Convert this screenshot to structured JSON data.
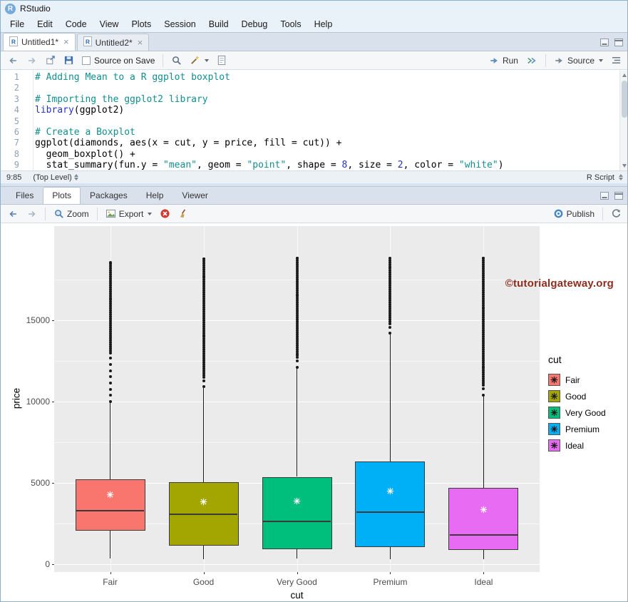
{
  "window": {
    "title": "RStudio"
  },
  "menu": {
    "items": [
      "File",
      "Edit",
      "Code",
      "View",
      "Plots",
      "Session",
      "Build",
      "Debug",
      "Tools",
      "Help"
    ]
  },
  "source_pane": {
    "tabs": [
      {
        "label": "Untitled1*",
        "active": true
      },
      {
        "label": "Untitled2*",
        "active": false
      }
    ],
    "toolbar": {
      "source_on_save": "Source on Save",
      "run": "Run",
      "source": "Source"
    },
    "status": {
      "cursor": "9:85",
      "scope": "(Top Level)",
      "file_type": "R Script"
    },
    "code_lines": [
      [
        [
          "# Adding Mean to a R ggplot boxplot",
          "c"
        ]
      ],
      [],
      [
        [
          "# Importing the ggplot2 library",
          "c"
        ]
      ],
      [
        [
          "library",
          "k"
        ],
        [
          "(ggplot2)",
          "d"
        ]
      ],
      [],
      [
        [
          "# Create a Boxplot",
          "c"
        ]
      ],
      [
        [
          "ggplot(diamonds, aes(x = cut, y = price, fill = cut)) +",
          "d"
        ]
      ],
      [
        [
          "  geom_boxplot() +",
          "d"
        ]
      ],
      [
        [
          "  stat_summary(fun.y = ",
          "d"
        ],
        [
          "\"mean\"",
          "s"
        ],
        [
          ", geom = ",
          "d"
        ],
        [
          "\"point\"",
          "s"
        ],
        [
          ", shape = ",
          "d"
        ],
        [
          "8",
          "n"
        ],
        [
          ", size = ",
          "d"
        ],
        [
          "2",
          "n"
        ],
        [
          ", color = ",
          "d"
        ],
        [
          "\"white\"",
          "s"
        ],
        [
          ")",
          "d"
        ]
      ]
    ]
  },
  "plots_pane": {
    "tabs": [
      "Files",
      "Plots",
      "Packages",
      "Help",
      "Viewer"
    ],
    "active_tab": "Plots",
    "toolbar": {
      "zoom": "Zoom",
      "export": "Export",
      "publish": "Publish"
    },
    "watermark": {
      "text": "©tutorialgateway.org",
      "color": "#8B2E1F"
    }
  },
  "chart_data": {
    "type": "boxplot",
    "title": "",
    "xlabel": "cut",
    "ylabel": "price",
    "legend_title": "cut",
    "legend_position": "right",
    "grid": true,
    "categories": [
      "Fair",
      "Good",
      "Very Good",
      "Premium",
      "Ideal"
    ],
    "colors": [
      "#F8766D",
      "#A3A500",
      "#00BF7D",
      "#00B0F6",
      "#E76BF3"
    ],
    "panel_background": "#EBEBEB",
    "mean_point_color": "#FFFFFF",
    "y_ticks": [
      0,
      5000,
      10000,
      15000
    ],
    "y_minor": [
      2500,
      7500,
      12500,
      17500
    ],
    "ylim": [
      -482,
      20789
    ],
    "series": [
      {
        "name": "Fair",
        "low": 337,
        "q1": 2050,
        "median": 3282,
        "q3": 5206,
        "high": 9940,
        "mean": 4359,
        "out_lo": 10000,
        "out_sparse_to": 13000,
        "out_hi": 18574
      },
      {
        "name": "Good",
        "low": 327,
        "q1": 1145,
        "median": 3050,
        "q3": 5028,
        "high": 10850,
        "mean": 3929,
        "out_lo": 10900,
        "out_sparse_to": 11500,
        "out_hi": 18788
      },
      {
        "name": "Very Good",
        "low": 336,
        "q1": 912,
        "median": 2648,
        "q3": 5373,
        "high": 12065,
        "mean": 3982,
        "out_lo": 12100,
        "out_sparse_to": 12700,
        "out_hi": 18818
      },
      {
        "name": "Premium",
        "low": 326,
        "q1": 1046,
        "median": 3185,
        "q3": 6296,
        "high": 14170,
        "mean": 4584,
        "out_lo": 14200,
        "out_sparse_to": 14800,
        "out_hi": 18823
      },
      {
        "name": "Ideal",
        "low": 326,
        "q1": 878,
        "median": 1810,
        "q3": 4678,
        "high": 10375,
        "mean": 3458,
        "out_lo": 10400,
        "out_sparse_to": 11000,
        "out_hi": 18806
      }
    ]
  }
}
